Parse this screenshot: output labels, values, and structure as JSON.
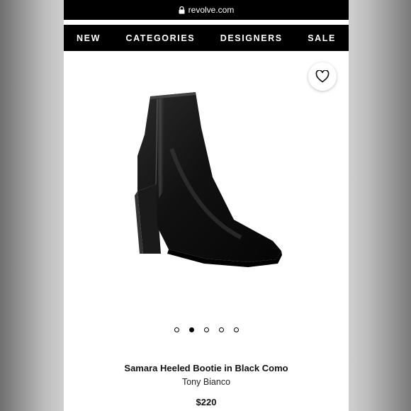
{
  "browser": {
    "url": "revolve.com"
  },
  "nav": {
    "items": [
      "NEW",
      "CATEGORIES",
      "DESIGNERS",
      "SALE"
    ]
  },
  "product": {
    "name": "Samara Heeled Bootie in Black Como",
    "brand": "Tony Bianco",
    "price": "$220",
    "image_icon": "ankle-boot-image"
  },
  "carousel": {
    "count": 5,
    "active_index": 1
  },
  "colors": {
    "nav_bg": "#000000",
    "page_bg": "#ffffff"
  }
}
